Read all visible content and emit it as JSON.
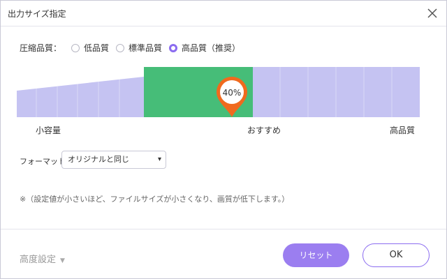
{
  "window": {
    "title": "出力サイズ指定"
  },
  "quality": {
    "label": "圧縮品質：",
    "options": [
      {
        "label": "低品質",
        "selected": false
      },
      {
        "label": "標準品質",
        "selected": false
      },
      {
        "label": "高品質（推奨）",
        "selected": true
      }
    ]
  },
  "slider": {
    "value_label": "40%",
    "value_percent": 40,
    "labels": {
      "left": "小容量",
      "middle": "おすすめ",
      "right": "高品質"
    },
    "colors": {
      "track": "#c5c3f2",
      "recommended": "#46bd78",
      "pin": "#f06a1e"
    }
  },
  "format": {
    "label": "フォーマット:",
    "selected": "オリジナルと同じ"
  },
  "note": "※（設定値が小さいほど、ファイルサイズが小さくなり、画質が低下します。）",
  "footer": {
    "advanced_label": "高度設定",
    "reset_label": "リセット",
    "ok_label": "OK"
  },
  "colors": {
    "accent": "#9b7ef0"
  }
}
